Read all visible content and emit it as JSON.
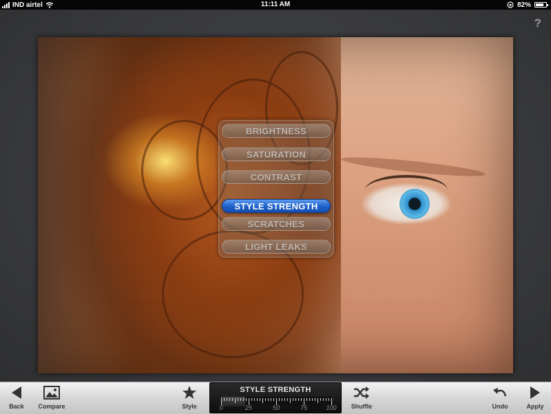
{
  "status_bar": {
    "carrier": "IND airtel",
    "time": "11:11 AM",
    "battery_text": "82%",
    "battery_level": 0.82
  },
  "help_label": "?",
  "param_menu": {
    "items": [
      {
        "label": "BRIGHTNESS",
        "active": false
      },
      {
        "label": "SATURATION",
        "active": false
      },
      {
        "label": "CONTRAST",
        "active": false
      },
      {
        "label": "STYLE STRENGTH",
        "active": true
      },
      {
        "label": "SCRATCHES",
        "active": false
      },
      {
        "label": "LIGHT LEAKS",
        "active": false
      }
    ]
  },
  "toolbar": {
    "back_label": "Back",
    "compare_label": "Compare",
    "style_label": "Style",
    "shuffle_label": "Shuffle",
    "undo_label": "Undo",
    "apply_label": "Apply"
  },
  "slider": {
    "title": "STYLE STRENGTH",
    "scale_labels": [
      "0",
      "25",
      "50",
      "75",
      "100"
    ],
    "value": 0.22
  },
  "colors": {
    "active_item": "#1c5fc9",
    "toolbar_bg": "#d7d7d7"
  }
}
